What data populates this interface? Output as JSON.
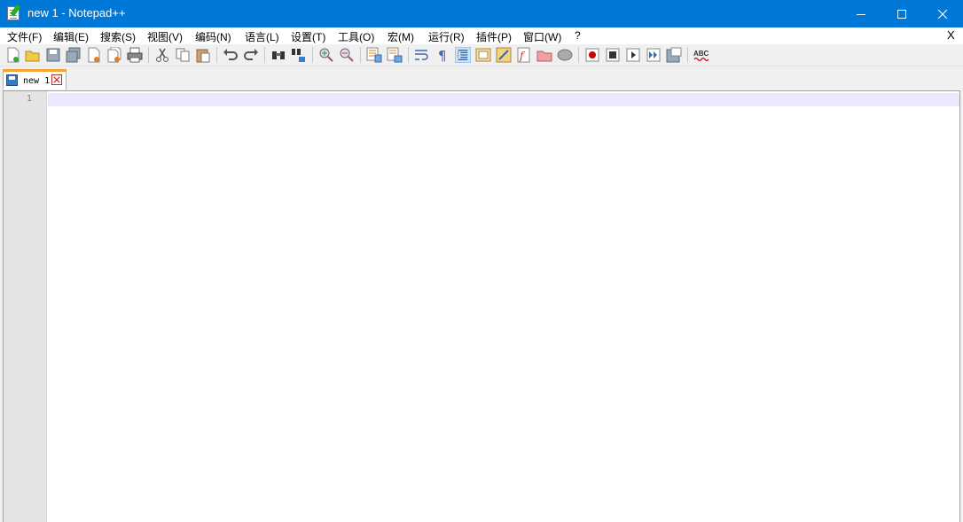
{
  "window": {
    "title": "new 1 - Notepad++"
  },
  "menu": {
    "items": [
      {
        "label": "文件(F)"
      },
      {
        "label": "编辑(E)"
      },
      {
        "label": "搜索(S)"
      },
      {
        "label": "视图(V)"
      },
      {
        "label": "编码(N)"
      },
      {
        "label": "语言(L)"
      },
      {
        "label": "设置(T)"
      },
      {
        "label": "工具(O)"
      },
      {
        "label": "宏(M)"
      },
      {
        "label": "运行(R)"
      },
      {
        "label": "插件(P)"
      },
      {
        "label": "窗口(W)"
      },
      {
        "label": "?"
      }
    ],
    "close_label": "X"
  },
  "toolbar": {
    "spellcheck_label": "ABC"
  },
  "tabs": [
    {
      "label": "new 1"
    }
  ],
  "editor": {
    "line_numbers": [
      "1"
    ]
  },
  "colors": {
    "titlebar": "#0078d7",
    "active_tab_accent": "#f8a232",
    "current_line": "#e8e8ff"
  }
}
